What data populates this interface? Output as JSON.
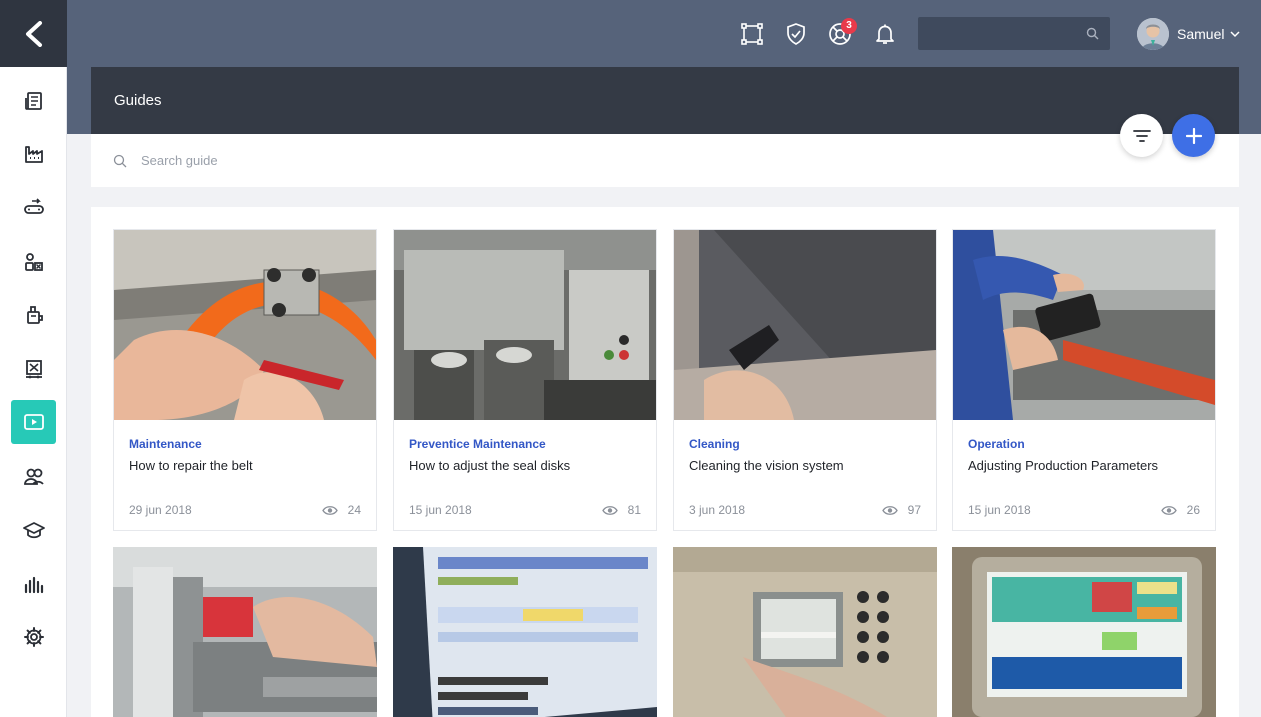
{
  "header": {
    "notifications_badge": "3",
    "user_name": "Samuel"
  },
  "page": {
    "title": "Guides",
    "search_placeholder": "Search guide"
  },
  "sidebar": {
    "items": [
      "news-icon",
      "factory-icon",
      "conveyor-icon",
      "shapes-icon",
      "machine-icon",
      "station-icon",
      "video-guide-icon",
      "users-icon",
      "training-icon",
      "analytics-icon",
      "settings-icon"
    ],
    "active_item": "video-guide-icon",
    "accent_color": "#27c9b7"
  },
  "guides": [
    {
      "category": "Maintenance",
      "title": "How to repair the belt",
      "date": "29 jun 2018",
      "views": "24"
    },
    {
      "category": "Preventice Maintenance",
      "title": "How to adjust the seal disks",
      "date": "15 jun 2018",
      "views": "81"
    },
    {
      "category": "Cleaning",
      "title": "Cleaning the vision system",
      "date": "3 jun 2018",
      "views": "97"
    },
    {
      "category": "Operation",
      "title": "Adjusting Production Parameters",
      "date": "15 jun 2018",
      "views": "26"
    }
  ],
  "colors": {
    "topbar": "#56637a",
    "header_band": "#343a45",
    "category_text": "#3357c6",
    "add_button": "#3e6fe6",
    "badge": "#e83a4a"
  }
}
